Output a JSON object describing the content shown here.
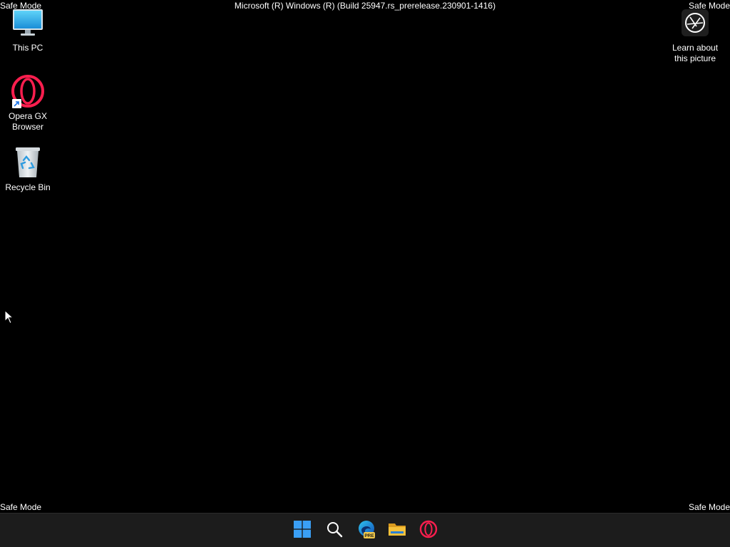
{
  "overlay": {
    "safe_mode_top_left": "Safe Mode",
    "safe_mode_top_right": "Safe Mode",
    "safe_mode_bottom_left": "Safe Mode",
    "safe_mode_bottom_right": "Safe Mode",
    "build_string": "Microsoft (R) Windows (R) (Build 25947.rs_prerelease.230901-1416)"
  },
  "desktop_icons": [
    {
      "label": "This PC",
      "icon": "monitor-icon"
    },
    {
      "label": "Opera GX\nBrowser",
      "icon": "opera-gx-icon",
      "shortcut": true
    },
    {
      "label": "Recycle Bin",
      "icon": "recycle-bin-icon"
    },
    {
      "label": "Learn about\nthis picture",
      "icon": "camera-icon"
    }
  ],
  "taskbar": {
    "items": [
      {
        "name": "start",
        "icon": "windows-start-icon"
      },
      {
        "name": "search",
        "icon": "search-icon"
      },
      {
        "name": "edge-canary",
        "icon": "edge-icon",
        "badge": "PRE"
      },
      {
        "name": "file-explorer",
        "icon": "folder-icon"
      },
      {
        "name": "opera-gx",
        "icon": "opera-gx-icon"
      }
    ]
  },
  "colors": {
    "desktop_background": "#000000",
    "taskbar_background": "#1c1c1c",
    "opera_red": "#fa1e4e",
    "windows_blue": "#3a9ff5",
    "folder_yellow": "#f5c13b"
  }
}
